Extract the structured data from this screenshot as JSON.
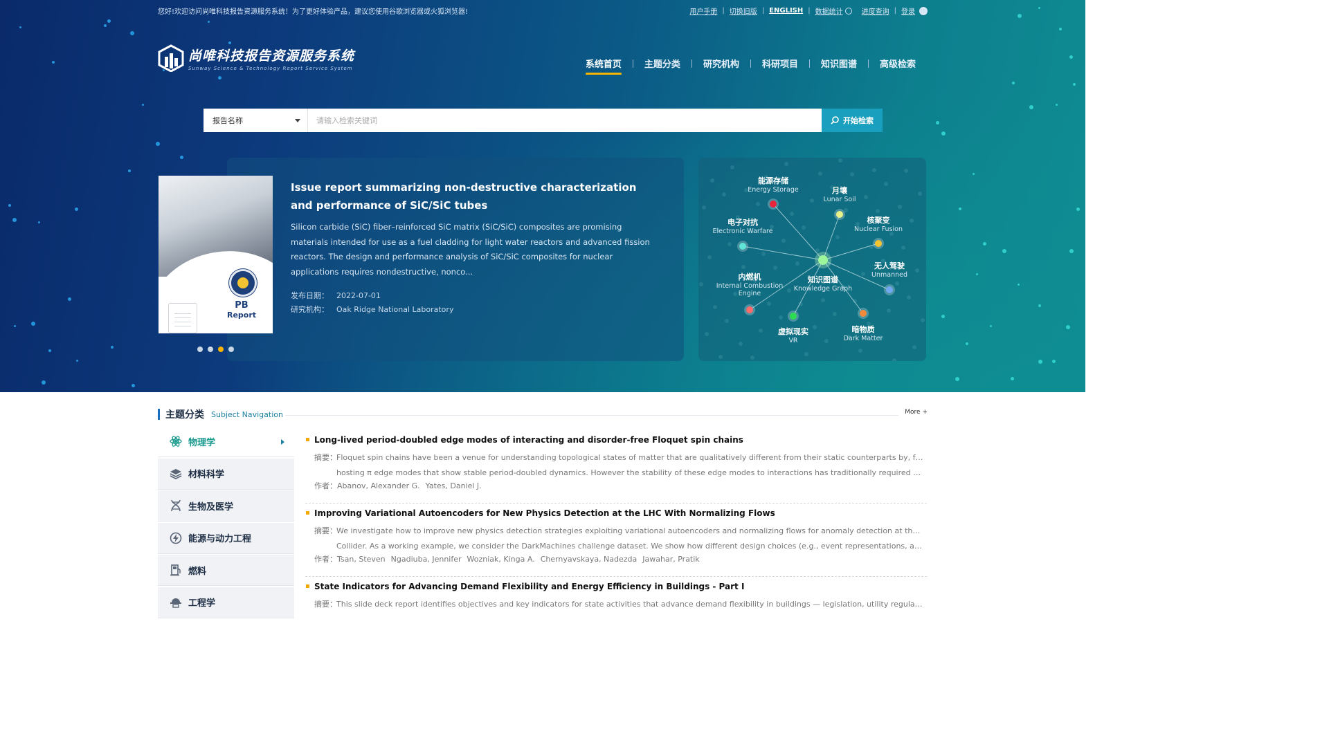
{
  "topbar": {
    "welcome": "您好!欢迎访问尚唯科技报告资源服务系统！为了更好体验产品，建议您使用谷歌浏览器或火狐浏览器!",
    "links": {
      "manual": "用户手册",
      "old_version": "切换旧版",
      "english": "ENGLISH",
      "stats": "数据统计",
      "progress": "进度查询",
      "login": "登录"
    }
  },
  "logo": {
    "cn": "尚唯科技报告资源服务系统",
    "en": "Sunway Science & Technology Report Service System"
  },
  "nav": [
    {
      "label": "系统首页",
      "active": true
    },
    {
      "label": "主题分类"
    },
    {
      "label": "研究机构"
    },
    {
      "label": "科研项目"
    },
    {
      "label": "知识图谱"
    },
    {
      "label": "高级检索"
    }
  ],
  "search": {
    "field": "报告名称",
    "placeholder": "请输入检索关键词",
    "button": "开始检索"
  },
  "slide": {
    "cover": {
      "line1": "PB",
      "line2": "Report"
    },
    "title": "Issue report summarizing non-destructive characterization and performance of SiC/SiC tubes",
    "desc": "Silicon carbide (SiC) fiber–reinforced SiC matrix (SiC/SiC) composites are promising materials intended for use as a fuel cladding for light water reactors and advanced fission reactors. The design and performance analysis of SiC/SiC composites for nuclear applications requires nondestructive, nonco...",
    "date_label": "发布日期：",
    "date": "2022-07-01",
    "org_label": "研究机构：",
    "org": "Oak Ridge National Laboratory",
    "pages": 4,
    "active_page": 3
  },
  "kg": {
    "center": {
      "cn": "知识图谱",
      "en": "Knowledge Graph"
    },
    "nodes": [
      {
        "cn": "能源存储",
        "en": "Energy Storage",
        "color": "#e8253a"
      },
      {
        "cn": "月壤",
        "en": "Lunar Soil",
        "color": "#eaf28a"
      },
      {
        "cn": "核聚变",
        "en": "Nuclear Fusion",
        "color": "#f5c330"
      },
      {
        "cn": "电子对抗",
        "en": "Electronic Warfare",
        "color": "#5fe6d6"
      },
      {
        "cn": "无人驾驶",
        "en": "Unmanned",
        "color": "#6fa8f0"
      },
      {
        "cn": "内燃机",
        "en": "Internal Combustion Engine",
        "color": "#ff6b6b"
      },
      {
        "cn": "虚拟现实",
        "en": "VR",
        "color": "#2cdd52"
      },
      {
        "cn": "暗物质",
        "en": "Dark Matter",
        "color": "#f28a3a"
      }
    ]
  },
  "section": {
    "title_cn": "主题分类",
    "title_en": "Subject Navigation",
    "more": "More +"
  },
  "subjects": [
    {
      "label": "物理学",
      "icon": "atom-icon",
      "active": true
    },
    {
      "label": "材料科学",
      "icon": "layers-icon"
    },
    {
      "label": "生物及医学",
      "icon": "dna-icon"
    },
    {
      "label": "能源与动力工程",
      "icon": "power-icon"
    },
    {
      "label": "燃料",
      "icon": "fuel-icon"
    },
    {
      "label": "工程学",
      "icon": "engineering-icon"
    }
  ],
  "articles": [
    {
      "title": "Long-lived period-doubled edge modes of interacting and disorder-free Floquet spin chains",
      "abstract_label": "摘要：",
      "abstract_1": "Floquet spin chains have been a venue for understanding topological states of matter that are qualitatively different from their static counterparts by, for example,",
      "abstract_2": "hosting π edge modes that show stable period-doubled dynamics. However the stability of these edge modes to interactions has traditionally required the system to...",
      "author_label": "作者：",
      "authors": [
        "Abanov, Alexander G.",
        "Yates, Daniel J."
      ]
    },
    {
      "title": "Improving Variational Autoencoders for New Physics Detection at the LHC With Normalizing Flows",
      "abstract_label": "摘要：",
      "abstract_1": "We investigate how to improve new physics detection strategies exploiting variational autoencoders and normalizing flows for anomaly detection at the Large Hadron",
      "abstract_2": "Collider. As a working example, we consider the DarkMachines challenge dataset. We show how different design choices (e.g., event representations, anomaly score...",
      "author_label": "作者：",
      "authors": [
        "Tsan, Steven",
        "Ngadiuba, Jennifer",
        "Wozniak, Kinga A.",
        "Chernyavskaya, Nadezda",
        "Jawahar, Pratik"
      ]
    },
    {
      "title": "State Indicators for Advancing Demand Flexibility and Energy Efficiency in Buildings - Part I",
      "abstract_label": "摘要：",
      "abstract_1": "This slide deck report identifies objectives and key indicators for state activities that advance demand flexibility in buildings — legislation, utility regulatory",
      "abstract_2": "",
      "author_label": "",
      "authors": []
    }
  ]
}
